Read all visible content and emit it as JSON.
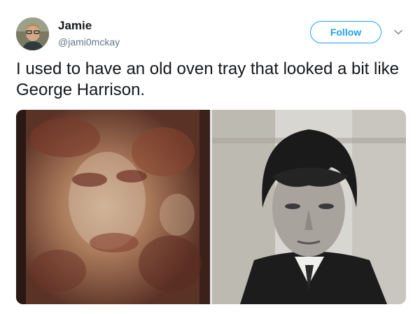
{
  "user": {
    "display_name": "Jamie",
    "handle": "@jami0mckay",
    "avatar_icon": "profile-photo"
  },
  "actions": {
    "follow_label": "Follow",
    "more_icon": "chevron-down-icon"
  },
  "tweet": {
    "text": "I used to have an old oven tray that looked a bit like George Harrison."
  },
  "media": {
    "left_image": "oven-tray-photo",
    "right_image": "portrait-photo"
  },
  "colors": {
    "accent": "#1da1f2",
    "text": "#14171a",
    "secondary": "#657786"
  }
}
